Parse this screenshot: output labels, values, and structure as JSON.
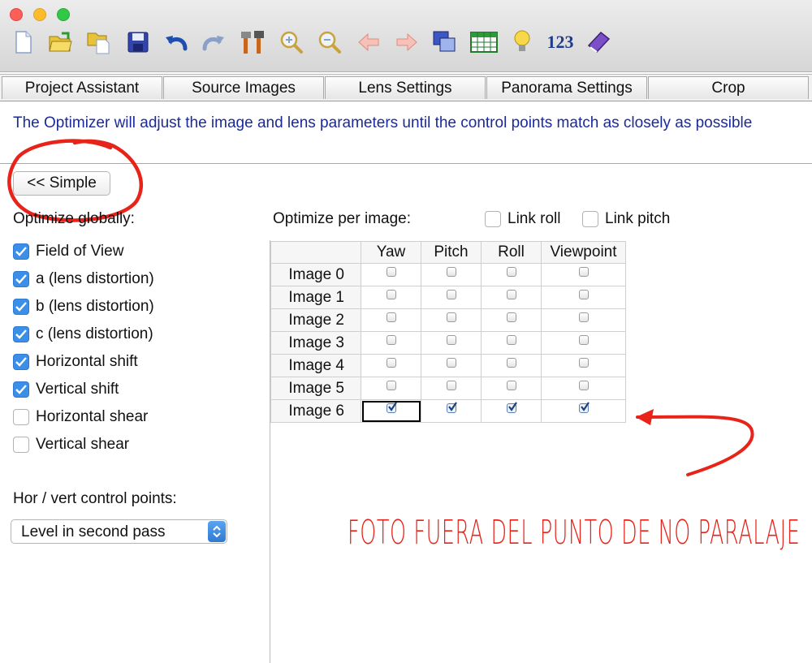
{
  "toolbar": {
    "icons": [
      "new-file-icon",
      "open-folder-icon",
      "open-recent-icon",
      "save-icon",
      "undo-icon",
      "redo-icon",
      "tools-icon",
      "zoom-in-icon",
      "zoom-out-icon",
      "previous-icon",
      "next-icon",
      "preview-icon",
      "table-icon",
      "hint-bulb-icon",
      "numbers-icon",
      "help-book-icon"
    ],
    "numbers_label": "123"
  },
  "tabs": [
    {
      "label": "Project Assistant"
    },
    {
      "label": "Source Images"
    },
    {
      "label": "Lens Settings"
    },
    {
      "label": "Panorama Settings"
    },
    {
      "label": "Crop"
    }
  ],
  "info_text": "The Optimizer will adjust the image and lens parameters until the control points match as closely as possible",
  "simple_button": "<< Simple",
  "global": {
    "title": "Optimize globally:",
    "options": [
      {
        "label": "Field of View",
        "checked": true
      },
      {
        "label": "a (lens distortion)",
        "checked": true
      },
      {
        "label": "b (lens distortion)",
        "checked": true
      },
      {
        "label": "c (lens distortion)",
        "checked": true
      },
      {
        "label": "Horizontal shift",
        "checked": true
      },
      {
        "label": "Vertical shift",
        "checked": true
      },
      {
        "label": "Horizontal shear",
        "checked": false
      },
      {
        "label": "Vertical shear",
        "checked": false
      }
    ]
  },
  "cp": {
    "title": "Hor / vert control points:",
    "selected": "Level in second pass"
  },
  "per_image": {
    "title": "Optimize per image:",
    "link_roll": {
      "label": "Link roll",
      "checked": false
    },
    "link_pitch": {
      "label": "Link pitch",
      "checked": false
    },
    "columns": [
      "Yaw",
      "Pitch",
      "Roll",
      "Viewpoint"
    ],
    "rows": [
      {
        "label": "Image 0",
        "values": [
          false,
          false,
          false,
          false
        ]
      },
      {
        "label": "Image 1",
        "values": [
          false,
          false,
          false,
          false
        ]
      },
      {
        "label": "Image 2",
        "values": [
          false,
          false,
          false,
          false
        ]
      },
      {
        "label": "Image 3",
        "values": [
          false,
          false,
          false,
          false
        ]
      },
      {
        "label": "Image 4",
        "values": [
          false,
          false,
          false,
          false
        ]
      },
      {
        "label": "Image 5",
        "values": [
          false,
          false,
          false,
          false
        ]
      },
      {
        "label": "Image 6",
        "values": [
          true,
          true,
          true,
          true
        ]
      }
    ]
  },
  "annotation": {
    "text": "FOTO FUERA DEL PUNTO DE NO PARALAJE",
    "color": "#e8231a"
  }
}
